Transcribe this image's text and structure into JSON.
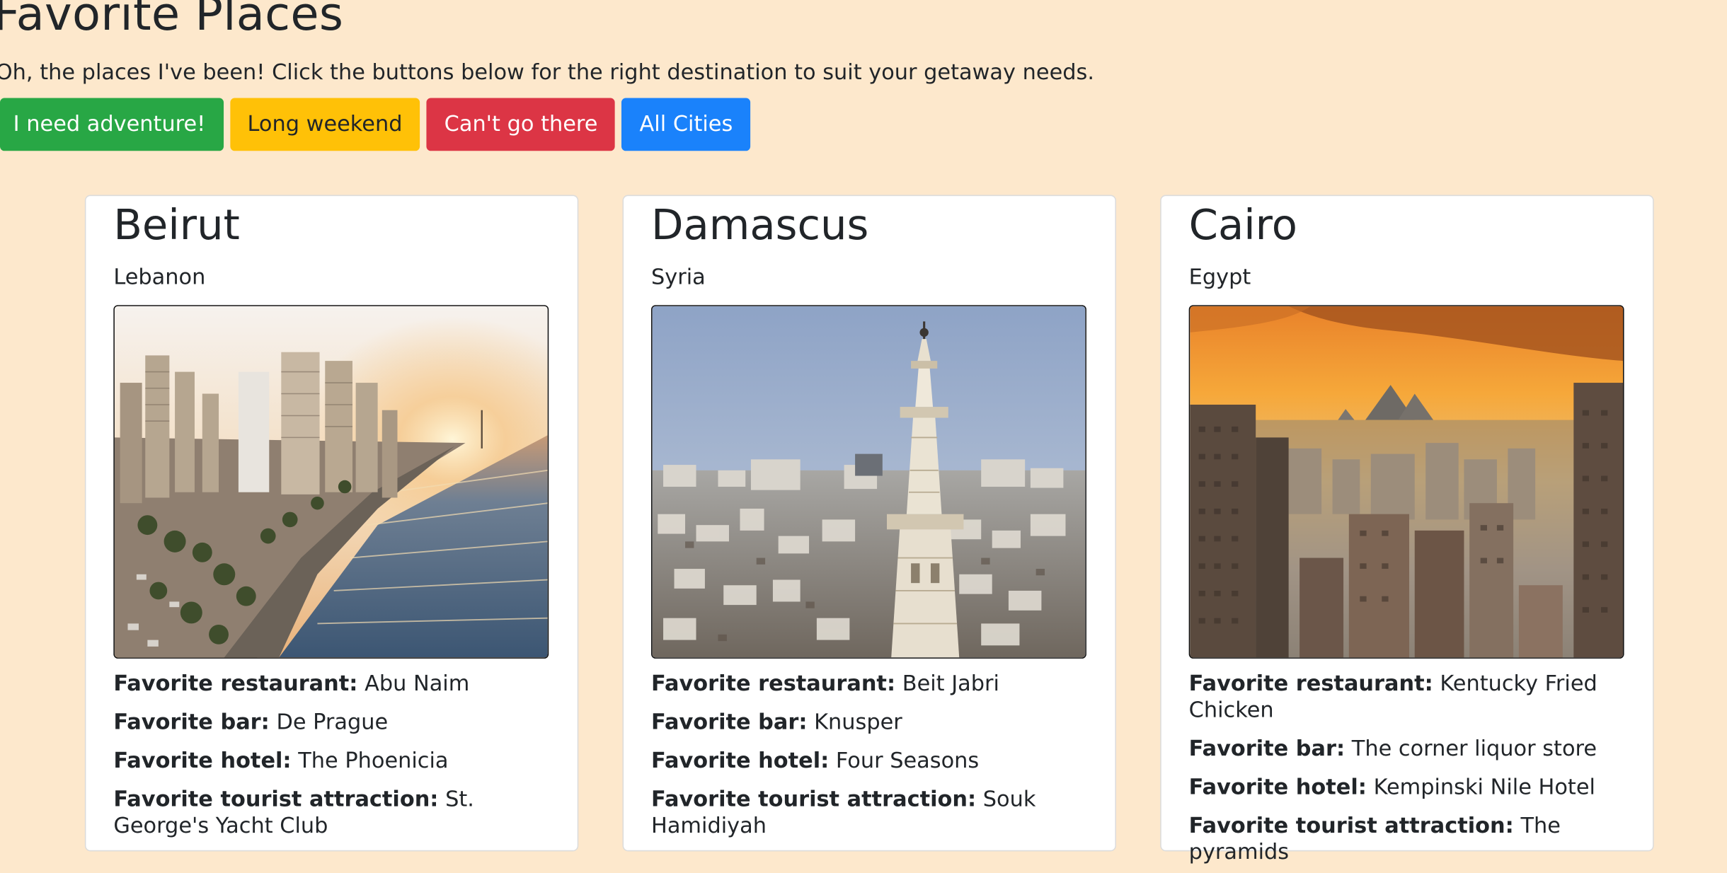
{
  "header": {
    "title": "Favorite Places",
    "subtitle": "Oh, the places I've been! Click the buttons below for the right destination to suit your getaway needs."
  },
  "filters": {
    "adventure": "I need adventure!",
    "weekend": "Long weekend",
    "cant_go": "Can't go there",
    "all": "All Cities"
  },
  "labels": {
    "restaurant": "Favorite restaurant:",
    "bar": "Favorite bar:",
    "hotel": "Favorite hotel:",
    "attraction": "Favorite tourist attraction:"
  },
  "cities": [
    {
      "name": "Beirut",
      "country": "Lebanon",
      "restaurant": "Abu Naim",
      "bar": "De Prague",
      "hotel": "The Phoenicia",
      "attraction": "St. George's Yacht Club"
    },
    {
      "name": "Damascus",
      "country": "Syria",
      "restaurant": "Beit Jabri",
      "bar": "Knusper",
      "hotel": "Four Seasons",
      "attraction": "Souk Hamidiyah"
    },
    {
      "name": "Cairo",
      "country": "Egypt",
      "restaurant": "Kentucky Fried Chicken",
      "bar": "The corner liquor store",
      "hotel": "Kempinski Nile Hotel",
      "attraction": "The pyramids"
    }
  ],
  "colors": {
    "page_bg": "#fde8cc",
    "success": "#28a745",
    "warning": "#ffc107",
    "danger": "#dc3545",
    "primary": "#1a82fb"
  }
}
